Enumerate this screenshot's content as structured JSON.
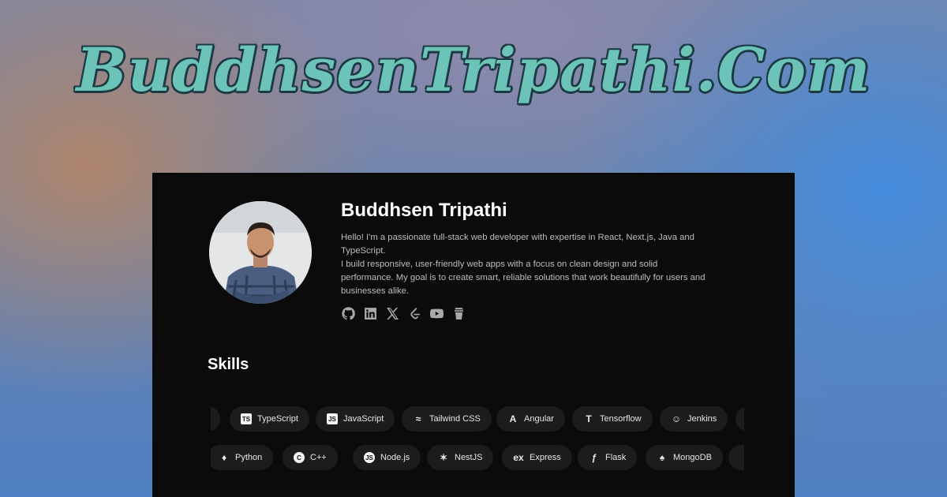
{
  "site_title": "BuddhsenTripathi.Com",
  "profile": {
    "name": "Buddhsen Tripathi",
    "bio_line1": "Hello! I'm a passionate full-stack web developer with expertise in React, Next.js, Java and TypeScript.",
    "bio_line2": "I build responsive, user-friendly web apps with a focus on clean design and solid performance. My goal is to create smart, reliable solutions that work beautifully for users and businesses alike."
  },
  "socials": [
    {
      "icon": "github-icon"
    },
    {
      "icon": "linkedin-icon"
    },
    {
      "icon": "x-icon"
    },
    {
      "icon": "leetcode-icon"
    },
    {
      "icon": "youtube-icon"
    },
    {
      "icon": "buymeacoffee-icon"
    }
  ],
  "skills": {
    "title": "Skills",
    "row1": [
      {
        "label": "TypeScript",
        "icon": "typescript-icon",
        "glyph": "TS"
      },
      {
        "label": "JavaScript",
        "icon": "javascript-icon",
        "glyph": "JS"
      },
      {
        "label": "Tailwind CSS",
        "icon": "tailwind-icon",
        "glyph": "≈"
      },
      {
        "label": "Angular",
        "icon": "angular-icon",
        "glyph": "A"
      },
      {
        "label": "Tensorflow",
        "icon": "tensorflow-icon",
        "glyph": "T"
      },
      {
        "label": "Jenkins",
        "icon": "jenkins-icon",
        "glyph": "☺"
      }
    ],
    "row2": [
      {
        "label": "Python",
        "icon": "python-icon",
        "glyph": "♦"
      },
      {
        "label": "C++",
        "icon": "cplusplus-icon",
        "glyph": "C"
      },
      {
        "label": "Node.js",
        "icon": "nodejs-icon",
        "glyph": "JS"
      },
      {
        "label": "NestJS",
        "icon": "nestjs-icon",
        "glyph": "✶"
      },
      {
        "label": "Express",
        "icon": "express-icon",
        "glyph": "ex"
      },
      {
        "label": "Flask",
        "icon": "flask-icon",
        "glyph": "ƒ"
      },
      {
        "label": "MongoDB",
        "icon": "mongodb-icon",
        "glyph": "♠"
      }
    ]
  }
}
